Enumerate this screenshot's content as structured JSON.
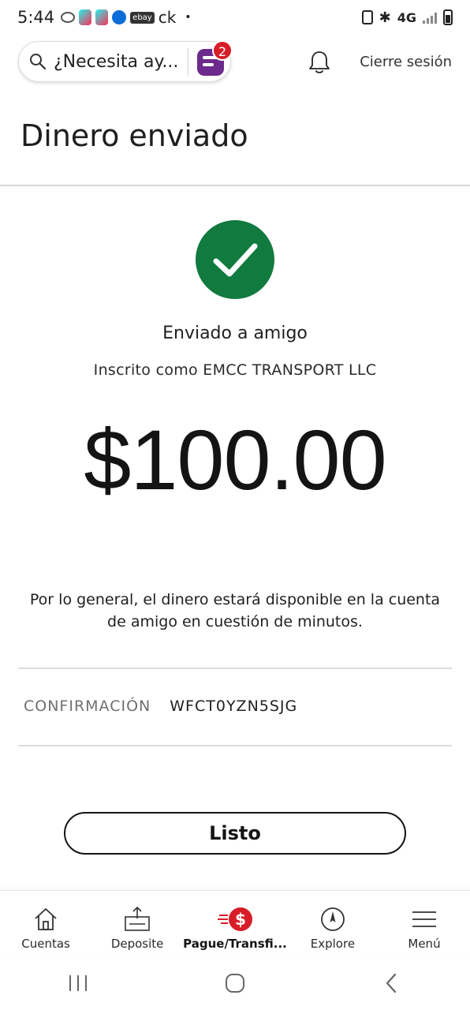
{
  "status_bar": {
    "time": "5:44",
    "left_text": "ck",
    "ebay_label": "ebay",
    "dot": "•",
    "network": "4G"
  },
  "header": {
    "search_placeholder": "¿Necesita ay...",
    "badge_count": "2",
    "signout_label": "Cierre sesión"
  },
  "page": {
    "title": "Dinero enviado"
  },
  "confirmation": {
    "sent_label": "Enviado a amigo",
    "enrolled_as": "Inscrito como EMCC TRANSPORT LLC",
    "amount": "$100.00",
    "notice": "Por lo general, el dinero estará disponible en la cuenta de amigo en cuestión de minutos.",
    "conf_label": "CONFIRMACIÓN",
    "conf_value": "WFCT0YZN5SJG",
    "done_label": "Listo",
    "success_color": "#117a3f"
  },
  "bottom_nav": {
    "items": [
      {
        "label": "Cuentas",
        "icon": "home-icon"
      },
      {
        "label": "Deposite",
        "icon": "deposit-icon"
      },
      {
        "label": "Pague/Transfi...",
        "icon": "pay-transfer-icon",
        "active": true
      },
      {
        "label": "Explore",
        "icon": "compass-icon"
      },
      {
        "label": "Menú",
        "icon": "menu-icon"
      }
    ],
    "accent": "#d71e28"
  }
}
